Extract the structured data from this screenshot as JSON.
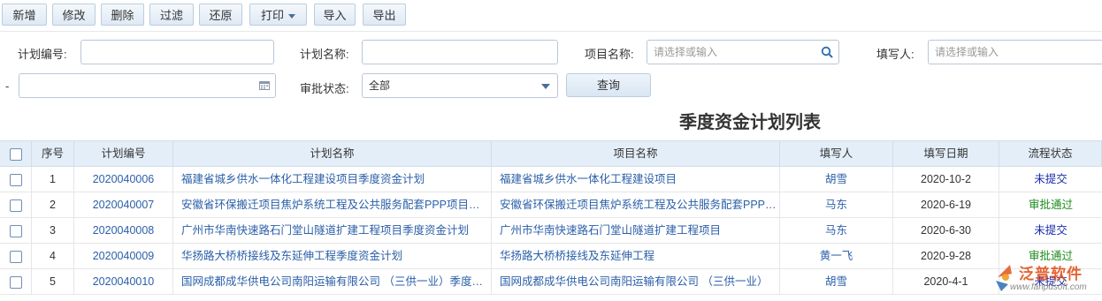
{
  "toolbar": {
    "buttons": [
      "新增",
      "修改",
      "删除",
      "过滤",
      "还原",
      "打印",
      "导入",
      "导出"
    ]
  },
  "filters": {
    "plan_no_label": "计划编号:",
    "plan_name_label": "计划名称:",
    "project_label": "项目名称:",
    "project_placeholder": "请选择或输入",
    "writer_label": "填写人:",
    "writer_placeholder": "请选择或输入",
    "date_sep": "-",
    "status_label": "审批状态:",
    "status_value": "全部",
    "query_label": "查询"
  },
  "title": "季度资金计划列表",
  "table": {
    "headers": [
      "序号",
      "计划编号",
      "计划名称",
      "项目名称",
      "填写人",
      "填写日期",
      "流程状态"
    ],
    "rows": [
      {
        "no": "1",
        "code": "2020040006",
        "name": "福建省城乡供水一体化工程建设项目季度资金计划",
        "project": "福建省城乡供水一体化工程建设项目",
        "writer": "胡雪",
        "date": "2020-10-2",
        "status": "未提交"
      },
      {
        "no": "2",
        "code": "2020040007",
        "name": "安徽省环保搬迁项目焦炉系统工程及公共服务配套PPP项目季度资金计划",
        "project": "安徽省环保搬迁项目焦炉系统工程及公共服务配套PPP项目",
        "writer": "马东",
        "date": "2020-6-19",
        "status": "审批通过"
      },
      {
        "no": "3",
        "code": "2020040008",
        "name": "广州市华南快速路石门堂山隧道扩建工程项目季度资金计划",
        "project": "广州市华南快速路石门堂山隧道扩建工程项目",
        "writer": "马东",
        "date": "2020-6-30",
        "status": "未提交"
      },
      {
        "no": "4",
        "code": "2020040009",
        "name": "华扬路大桥桥接线及东延伸工程季度资金计划",
        "project": "华扬路大桥桥接线及东延伸工程",
        "writer": "黄一飞",
        "date": "2020-9-28",
        "status": "审批通过"
      },
      {
        "no": "5",
        "code": "2020040010",
        "name": "国网成都成华供电公司南阳运输有限公司 （三供一业）季度资金计划",
        "project": "国网成都成华供电公司南阳运输有限公司 （三供一业）",
        "writer": "胡雪",
        "date": "2020-4-1",
        "status": "未提交"
      }
    ]
  },
  "watermark": {
    "brand": "泛普软件",
    "url": "www.fanpusoft.com"
  },
  "colors": {
    "link": "#2b5fa8",
    "status_pending": "#1a2cab",
    "status_approved": "#1e8a1e",
    "header_bg": "#e4eef8",
    "watermark": "#e0541e"
  }
}
